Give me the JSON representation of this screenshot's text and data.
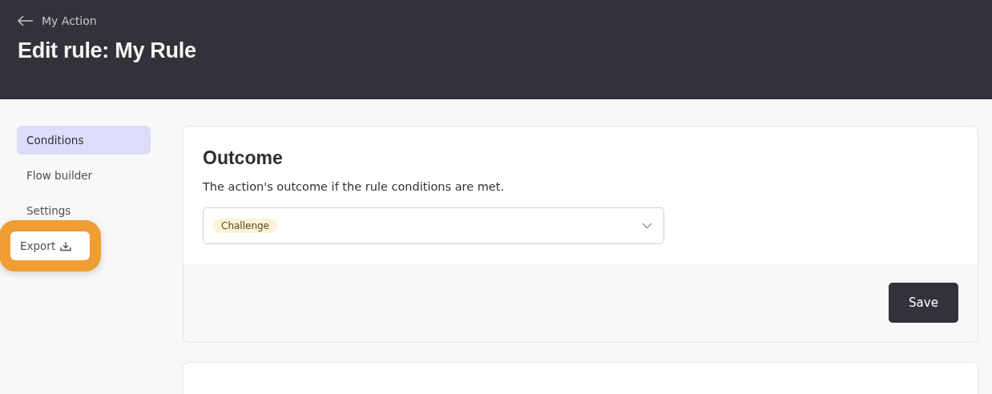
{
  "header": {
    "back_link": "My Action",
    "title": "Edit rule: My Rule"
  },
  "sidebar": {
    "items": [
      {
        "label": "Conditions",
        "selected": true,
        "highlighted": false,
        "kind": "plain"
      },
      {
        "label": "Flow builder",
        "selected": false,
        "highlighted": false,
        "kind": "plain"
      },
      {
        "label": "Settings",
        "selected": false,
        "highlighted": false,
        "kind": "plain"
      },
      {
        "label": "Export",
        "selected": false,
        "highlighted": true,
        "kind": "download"
      }
    ]
  },
  "outcome_card": {
    "title": "Outcome",
    "description": "The action's outcome if the rule conditions are met.",
    "select": {
      "value": "Challenge"
    },
    "save_button": "Save"
  },
  "conditions_card": {
    "kind": "cut-off"
  }
}
